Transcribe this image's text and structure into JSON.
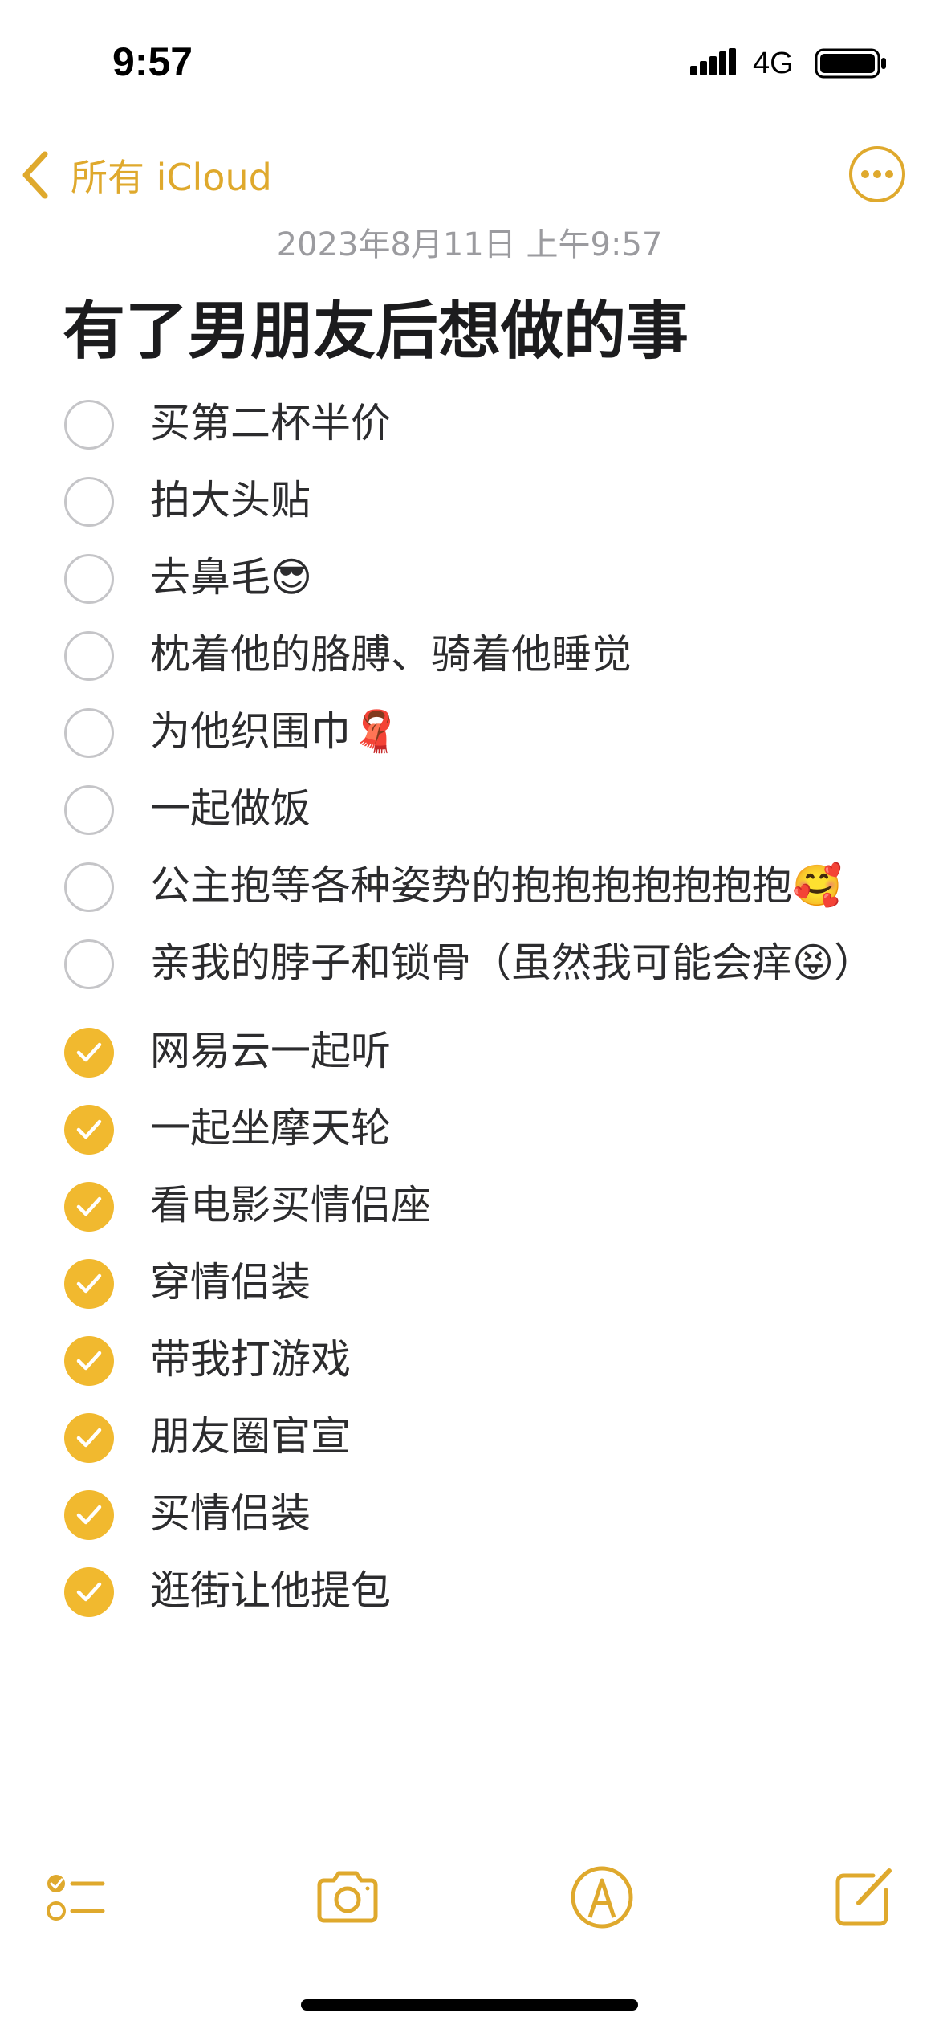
{
  "status_bar": {
    "time": "9:57",
    "network": "4G"
  },
  "nav": {
    "back_label": "所有 iCloud",
    "back_icon": "chevron-left-icon",
    "more_icon": "ellipsis-circle-icon"
  },
  "note": {
    "date": "2023年8月11日 上午9:57",
    "title": "有了男朋友后想做的事",
    "items": [
      {
        "text": "买第二杯半价",
        "checked": false
      },
      {
        "text": "拍大头贴",
        "checked": false
      },
      {
        "text": "去鼻毛😎",
        "checked": false
      },
      {
        "text": "枕着他的胳膊、骑着他睡觉",
        "checked": false
      },
      {
        "text": "为他织围巾🧣",
        "checked": false
      },
      {
        "text": "一起做饭",
        "checked": false
      },
      {
        "text": "公主抱等各种姿势的抱抱抱抱抱抱抱🥰",
        "checked": false
      },
      {
        "text": "亲我的脖子和锁骨（虽然我可能会痒😝）",
        "checked": false
      },
      {
        "text": "网易云一起听",
        "checked": true
      },
      {
        "text": "一起坐摩天轮",
        "checked": true
      },
      {
        "text": "看电影买情侣座",
        "checked": true
      },
      {
        "text": "穿情侣装",
        "checked": true
      },
      {
        "text": "带我打游戏",
        "checked": true
      },
      {
        "text": "朋友圈官宣",
        "checked": true
      },
      {
        "text": "买情侣装",
        "checked": true
      },
      {
        "text": "逛街让他提包",
        "checked": true
      }
    ]
  },
  "toolbar": {
    "items": [
      "checklist-icon",
      "camera-icon",
      "markup-pen-icon",
      "compose-icon"
    ]
  },
  "colors": {
    "accent": "#dfa92d",
    "check_fill": "#f1b92f",
    "unchecked_border": "#c5c5c8",
    "date_text": "#9b9b9f"
  }
}
